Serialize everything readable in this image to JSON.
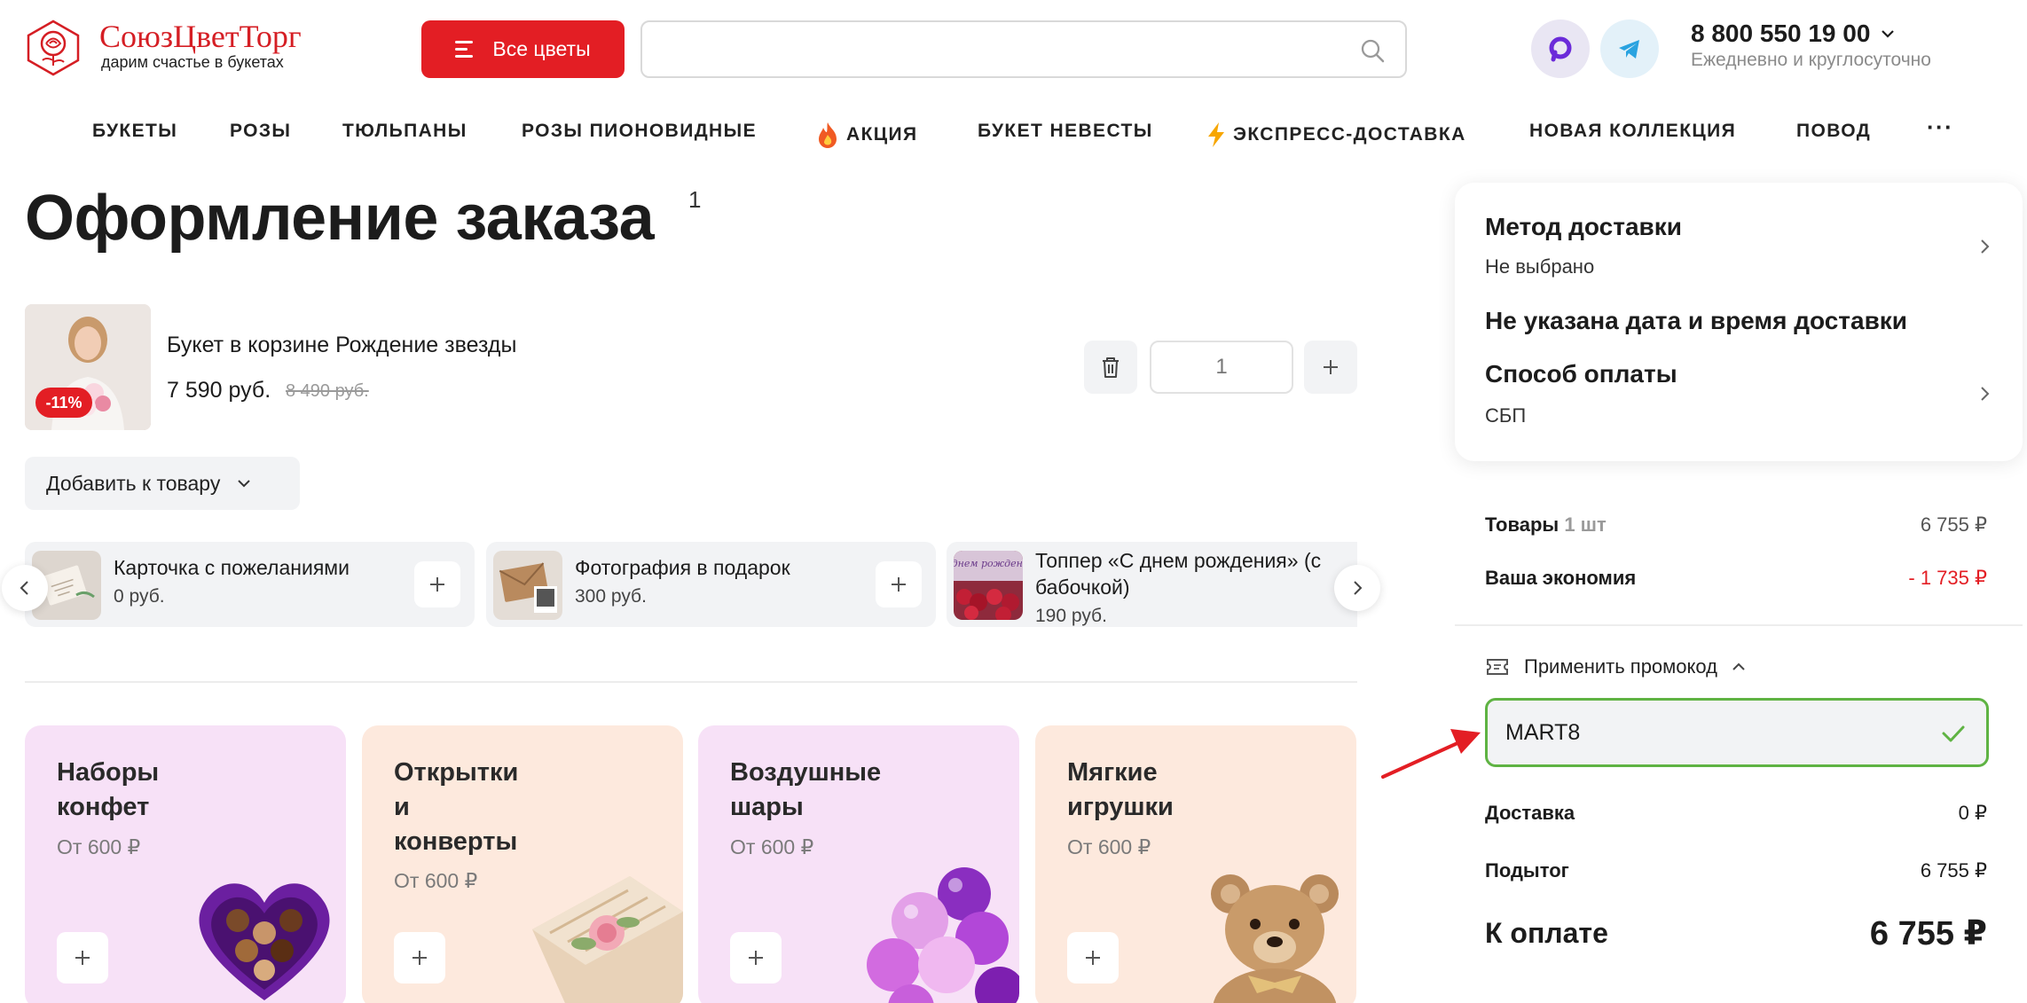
{
  "header": {
    "logo_name": "СоюзЦветТорг",
    "logo_tagline": "дарим счастье в букетах",
    "all_flowers_label": "Все цветы",
    "search_placeholder": "",
    "phone": "8 800 550 19 00",
    "phone_hours": "Ежедневно и круглосуточно",
    "social": [
      {
        "icon": "max-messenger-icon",
        "color": "#6b2bd9"
      },
      {
        "icon": "telegram-icon",
        "color": "#2aa3e0"
      }
    ]
  },
  "nav": {
    "items": [
      {
        "label": "БУКЕТЫ",
        "icon": ""
      },
      {
        "label": "РОЗЫ",
        "icon": ""
      },
      {
        "label": "ТЮЛЬПАНЫ",
        "icon": ""
      },
      {
        "label": "РОЗЫ ПИОНОВИДНЫЕ",
        "icon": ""
      },
      {
        "label": "АКЦИЯ",
        "icon": "fire-icon"
      },
      {
        "label": "БУКЕТ НЕВЕСТЫ",
        "icon": ""
      },
      {
        "label": "ЭКСПРЕСС-ДОСТАВКА",
        "icon": "lightning-icon"
      },
      {
        "label": "НОВАЯ КОЛЛЕКЦИЯ",
        "icon": ""
      },
      {
        "label": "ПОВОД",
        "icon": ""
      }
    ],
    "more_label": "···"
  },
  "page": {
    "title": "Оформление заказа",
    "count": "1"
  },
  "cart_item": {
    "name": "Букет в корзине Рождение звезды",
    "price": "7 590 руб.",
    "old_price": "8 490 руб.",
    "discount": "-11%",
    "quantity": "1"
  },
  "add_to_item_label": "Добавить к товару",
  "addons": [
    {
      "name": "Карточка с пожеланиями",
      "price": "0 руб."
    },
    {
      "name": "Фотография в подарок",
      "price": "300 руб."
    },
    {
      "name": "Топпер «С днем рождения» (с бабочкой)",
      "price": "190 руб.",
      "image_text": "С днем рождения"
    }
  ],
  "categories": [
    {
      "title": "Наборы конфет",
      "price": "От 600 ₽",
      "bg": "#f7e1f7"
    },
    {
      "title": "Открытки и конверты",
      "price": "От 600 ₽",
      "bg": "#fde9dd"
    },
    {
      "title": "Воздушные шары",
      "price": "От 600 ₽",
      "bg": "#f7e1f7"
    },
    {
      "title": "Мягкие игрушки",
      "price": "От 600 ₽",
      "bg": "#fde9dd"
    }
  ],
  "checkout": {
    "delivery_method_title": "Метод доставки",
    "delivery_method_value": "Не выбрано",
    "delivery_date_title": "Не указана дата и время доставки",
    "payment_title": "Способ оплаты",
    "payment_value": "СБП",
    "goods_label": "Товары",
    "goods_count": "1 шт",
    "goods_value": "6 755 ₽",
    "savings_label": "Ваша экономия",
    "savings_value": "- 1 735 ₽",
    "promo_toggle_label": "Применить промокод",
    "promo_code": "MART8",
    "delivery_label": "Доставка",
    "delivery_value": "0 ₽",
    "subtotal_label": "Подытог",
    "subtotal_value": "6 755 ₽",
    "total_label": "К оплате",
    "total_value": "6 755 ₽"
  },
  "colors": {
    "brand_red": "#e31e24",
    "promo_valid": "#5fb343",
    "savings_red": "#e31e24"
  }
}
